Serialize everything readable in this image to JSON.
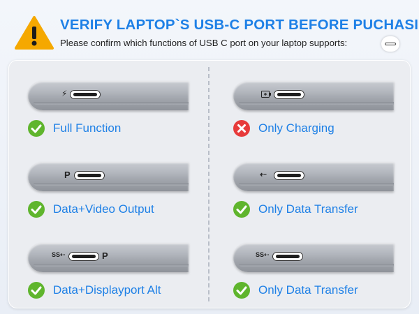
{
  "header": {
    "title": "VERIFY LAPTOP`S USB-C PORT BEFORE PUCHASING",
    "subtitle": "Please confirm which functions of USB C port on your laptop supports:",
    "warning_icon": "warning-triangle-icon",
    "accent_color": "#1e80e6",
    "warning_color": "#f5a800"
  },
  "symbols": {
    "ss_usb": "SS⇠",
    "usb": "⇠",
    "lightning": "⚡",
    "dp": "P"
  },
  "cards": [
    {
      "label": "Full Function",
      "status": "ok",
      "port_symbol": "lightning-icon"
    },
    {
      "label": "Only Charging",
      "status": "bad",
      "port_symbol": "battery-icon"
    },
    {
      "label": "Data+Video Output",
      "status": "ok",
      "port_symbol": "displayport-icon"
    },
    {
      "label": "Only Data Transfer",
      "status": "ok",
      "port_symbol": "usb-icon"
    },
    {
      "label": "Data+Displayport Alt",
      "status": "ok",
      "port_symbol": "ss-usb-and-displayport-icon"
    },
    {
      "label": "Only Data Transfer",
      "status": "ok",
      "port_symbol": "ss-usb-icon"
    }
  ]
}
